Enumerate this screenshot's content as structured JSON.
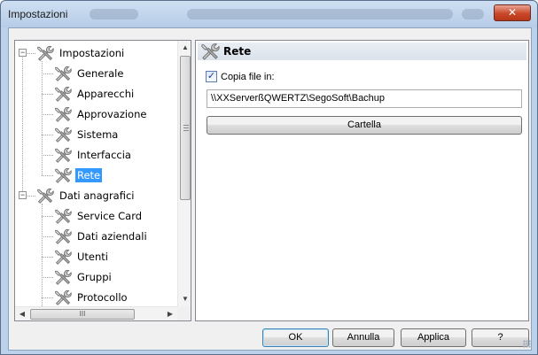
{
  "window": {
    "title": "Impostazioni",
    "close_glyph": "✕",
    "blurred_title_hint": "obscured window caption"
  },
  "tree": {
    "items": [
      {
        "label": "Impostazioni",
        "level": 0,
        "expanded": true,
        "icon": "tools-icon"
      },
      {
        "label": "Generale",
        "level": 1,
        "icon": "tools-icon"
      },
      {
        "label": "Apparecchi",
        "level": 1,
        "icon": "tools-icon"
      },
      {
        "label": "Approvazione",
        "level": 1,
        "icon": "tools-icon"
      },
      {
        "label": "Sistema",
        "level": 1,
        "icon": "tools-icon"
      },
      {
        "label": "Interfaccia",
        "level": 1,
        "icon": "tools-icon"
      },
      {
        "label": "Rete",
        "level": 1,
        "selected": true,
        "icon": "tools-icon"
      },
      {
        "label": "Dati anagrafici",
        "level": 0,
        "expanded": true,
        "icon": "tools-icon"
      },
      {
        "label": "Service Card",
        "level": 1,
        "icon": "tools-icon"
      },
      {
        "label": "Dati aziendali",
        "level": 1,
        "icon": "tools-icon"
      },
      {
        "label": "Utenti",
        "level": 1,
        "icon": "tools-icon"
      },
      {
        "label": "Gruppi",
        "level": 1,
        "icon": "tools-icon"
      },
      {
        "label": "Protocollo",
        "level": 1,
        "icon": "tools-icon"
      }
    ],
    "expander_glyph": "−",
    "scroll_up_glyph": "▲",
    "scroll_down_glyph": "▼",
    "scroll_left_glyph": "◀",
    "scroll_right_glyph": "▶",
    "hthumb_grip": "III"
  },
  "panel": {
    "title": "Rete",
    "checkbox_label": "Copia file in:",
    "checkbox_checked": true,
    "checkbox_glyph": "✓",
    "path_value": "\\\\XXServerßQWERTZ\\SegoSoft\\Bachup",
    "folder_button": "Cartella"
  },
  "buttons": {
    "ok": "OK",
    "cancel": "Annulla",
    "apply": "Applica",
    "help": "?"
  },
  "colors": {
    "selection": "#3399ff",
    "close_button": "#c9482a",
    "title_bar": "#bcd1ea"
  }
}
